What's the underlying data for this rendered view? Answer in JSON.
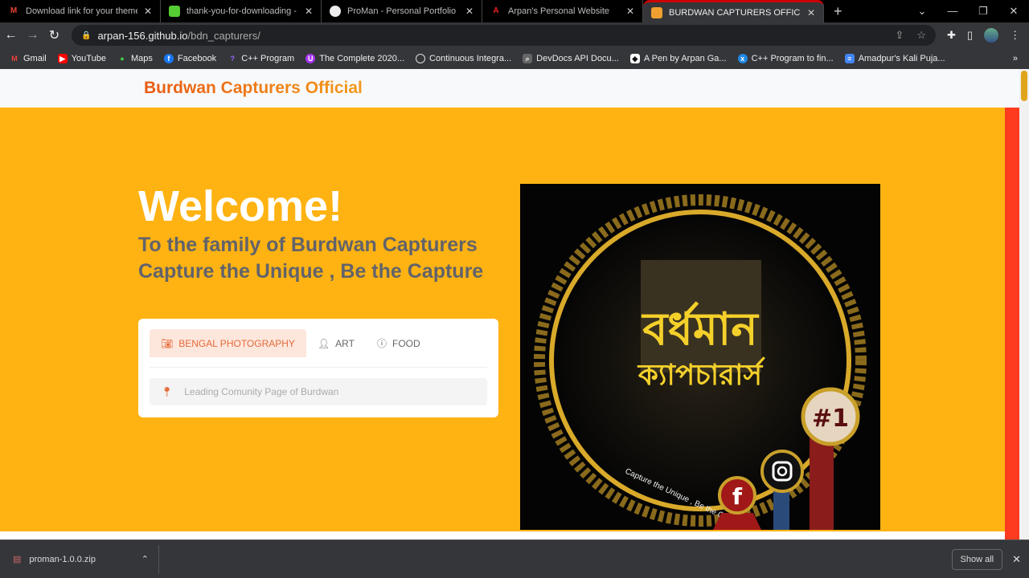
{
  "tabs": [
    {
      "title": "Download link for your theme is",
      "icon": "gmail-icon"
    },
    {
      "title": "thank-you-for-downloading - Th",
      "icon": "horse-icon"
    },
    {
      "title": "ProMan - Personal Portfolio HTM",
      "icon": "globe-icon"
    },
    {
      "title": "Arpan's Personal Website",
      "icon": "a-logo-icon"
    },
    {
      "title": "BURDWAN CAPTURERS OFFICIAL",
      "icon": "bus-icon"
    }
  ],
  "address": {
    "host": "arpan-156.github.io",
    "path": "/bdn_capturers/"
  },
  "bookmarks": [
    "Gmail",
    "YouTube",
    "Maps",
    "Facebook",
    "C++ Program",
    "The Complete 2020...",
    "Continuous Integra...",
    "DevDocs API Docu...",
    "A Pen by Arpan Ga...",
    "C++ Program to fin...",
    "Amadpur's Kali Puja..."
  ],
  "site": {
    "brand": "Burdwan Capturers Official",
    "welcome": "Welcome!",
    "sub1": "To the family of Burdwan Capturers",
    "sub2": "Capture the Unique , Be the Capture",
    "card_tabs": [
      "BENGAL PHOTOGRAPHY",
      "ART",
      "FOOD"
    ],
    "search_placeholder": "Leading Comunity Page of Burdwan",
    "logo": {
      "tagline": "Capture the Unique , Be the Capturer",
      "badge": "#1",
      "bengali": "বর্ধমান ক্যাপচারার্স অফিশিয়াল"
    }
  },
  "colors": {
    "hero": "#feb313",
    "accent": "#e95a13"
  },
  "download": {
    "file": "proman-1.0.0.zip",
    "show_all": "Show all"
  }
}
